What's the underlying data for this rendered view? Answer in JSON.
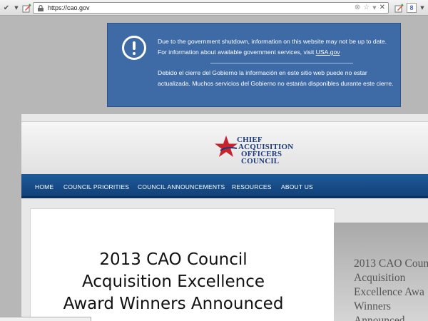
{
  "browser": {
    "url": "https://cao.gov",
    "icons": {
      "left": [
        "check-icon",
        "dropdown-arrow-icon",
        "edit-page-icon"
      ],
      "url_right": [
        "reload-icon",
        "bookmark-star-icon",
        "dropdown-arrow-icon",
        "stop-icon"
      ],
      "right": [
        "edit-page-icon",
        "google-search-icon",
        "dropdown-arrow-icon"
      ]
    }
  },
  "banner": {
    "en_text": "Due to the government shutdown, information on this website may not be up to date. For information about available government services, visit ",
    "en_link": "USA.gov",
    "es_text": "Debido el cierre del Gobierno la información en este sitio web puede no estar actualizada. Muchos servicios del Gobierno no estarán disponibles durante este cierre.",
    "accent": "#3e6aa6"
  },
  "logo": {
    "line1": "Chief",
    "line2": "Acquisition",
    "line3": "Officers",
    "line4": "Council",
    "star_color": "#c8232c",
    "text_color": "#1a3a7a"
  },
  "nav": {
    "items": [
      {
        "label": "HOME"
      },
      {
        "label": "COUNCIL PRIORITIES"
      },
      {
        "label": "COUNCIL ANNOUNCEMENTS"
      },
      {
        "label": "RESOURCES"
      },
      {
        "label": "ABOUT US"
      }
    ],
    "color": "#1d5a9a"
  },
  "main": {
    "headline_line1": "2013 CAO Council",
    "headline_line2": "Acquisition Excellence",
    "headline_line3": "Award Winners Announced",
    "side_line1": "2013 CAO Coun",
    "side_line2": "Acquisition",
    "side_line3": "Excellence Awa",
    "side_line4": "Winners",
    "side_line5": "Announced"
  }
}
